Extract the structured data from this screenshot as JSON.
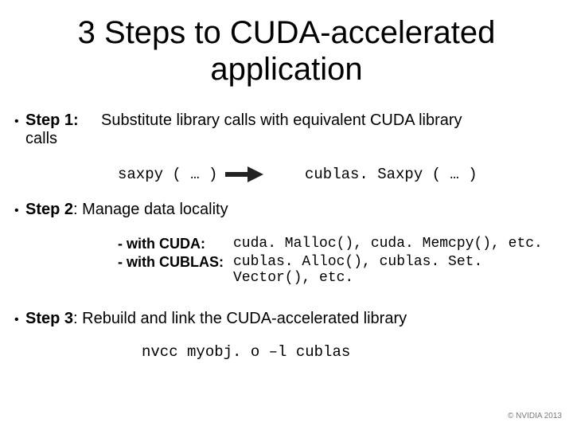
{
  "title_line1": "3 Steps to CUDA-accelerated",
  "title_line2": "application",
  "step1": {
    "label": "Step 1:",
    "wrap": "calls",
    "text": "Substitute library calls with equivalent CUDA library",
    "code_left": "saxpy ( … )",
    "code_right": "cublas. Saxpy ( … )"
  },
  "step2": {
    "label": "Step 2",
    "text": ": Manage data locality",
    "row1_label": "- with CUDA:",
    "row1_code": "cuda. Malloc(), cuda. Memcpy(), etc.",
    "row2_label": "- with CUBLAS:",
    "row2_code": "cublas. Alloc(), cublas. Set. Vector(), etc."
  },
  "step3": {
    "label": "Step 3",
    "text": ": Rebuild and link the CUDA-accelerated library",
    "code": "nvcc myobj. o –l cublas"
  },
  "footer": "© NVIDIA 2013"
}
